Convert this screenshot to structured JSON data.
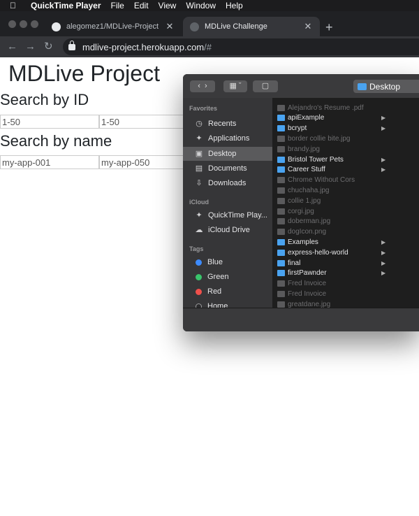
{
  "menubar": {
    "app": "QuickTime Player",
    "items": [
      "File",
      "Edit",
      "View",
      "Window",
      "Help"
    ]
  },
  "browser": {
    "tabs": [
      {
        "title": "alegomez1/MDLive-Project",
        "active": false,
        "icon": "github-icon"
      },
      {
        "title": "MDLive Challenge",
        "active": true,
        "icon": "globe-icon"
      }
    ],
    "url_host": "mdlive-project.herokuapp.com",
    "url_path": "/#"
  },
  "page": {
    "title": "MDLive Project",
    "search_id": {
      "heading": "Search by ID",
      "from_value": "1-50",
      "to_value": "1-50"
    },
    "search_name": {
      "heading": "Search by name",
      "from_value": "my-app-001",
      "to_value": "my-app-050"
    }
  },
  "finder": {
    "location": "Desktop",
    "sidebar": {
      "favorites_label": "Favorites",
      "favorites": [
        {
          "label": "Recents",
          "icon": "clock-icon"
        },
        {
          "label": "Applications",
          "icon": "applications-icon"
        },
        {
          "label": "Desktop",
          "icon": "desktop-icon",
          "selected": true
        },
        {
          "label": "Documents",
          "icon": "document-icon"
        },
        {
          "label": "Downloads",
          "icon": "download-icon"
        }
      ],
      "icloud_label": "iCloud",
      "icloud": [
        {
          "label": "QuickTime Play...",
          "icon": "applications-icon"
        },
        {
          "label": "iCloud Drive",
          "icon": "cloud-icon"
        }
      ],
      "tags_label": "Tags",
      "tags": [
        {
          "label": "Blue",
          "color": "#3d8bfd"
        },
        {
          "label": "Green",
          "color": "#39c46b"
        },
        {
          "label": "Red",
          "color": "#f0504b"
        },
        {
          "label": "Home",
          "color": "#2b2b2d"
        }
      ]
    },
    "files": [
      {
        "name": "Alejandro's Resume .pdf",
        "kind": "file",
        "dim": true
      },
      {
        "name": "apiExample",
        "kind": "folder",
        "dim": false
      },
      {
        "name": "bcrypt",
        "kind": "folder",
        "dim": false
      },
      {
        "name": "border collie bite.jpg",
        "kind": "file",
        "dim": true
      },
      {
        "name": "brandy.jpg",
        "kind": "file",
        "dim": true
      },
      {
        "name": "Bristol Tower Pets",
        "kind": "folder",
        "dim": false
      },
      {
        "name": "Career Stuff",
        "kind": "folder",
        "dim": false
      },
      {
        "name": "Chrome Without Cors",
        "kind": "file",
        "dim": true
      },
      {
        "name": "chuchaha.jpg",
        "kind": "file",
        "dim": true
      },
      {
        "name": "collie 1.jpg",
        "kind": "file",
        "dim": true
      },
      {
        "name": "corgi.jpg",
        "kind": "file",
        "dim": true
      },
      {
        "name": "doberman.jpg",
        "kind": "file",
        "dim": true
      },
      {
        "name": "dogIcon.png",
        "kind": "file",
        "dim": true
      },
      {
        "name": "Examples",
        "kind": "folder",
        "dim": false
      },
      {
        "name": "express-hello-world",
        "kind": "folder",
        "dim": false
      },
      {
        "name": "final",
        "kind": "folder",
        "dim": false
      },
      {
        "name": "firstPawnder",
        "kind": "folder",
        "dim": false
      },
      {
        "name": "Fred Invoice",
        "kind": "file",
        "dim": true
      },
      {
        "name": "Fred Invoice",
        "kind": "file",
        "dim": true
      },
      {
        "name": "greatdane.jpg",
        "kind": "file",
        "dim": true
      }
    ]
  }
}
